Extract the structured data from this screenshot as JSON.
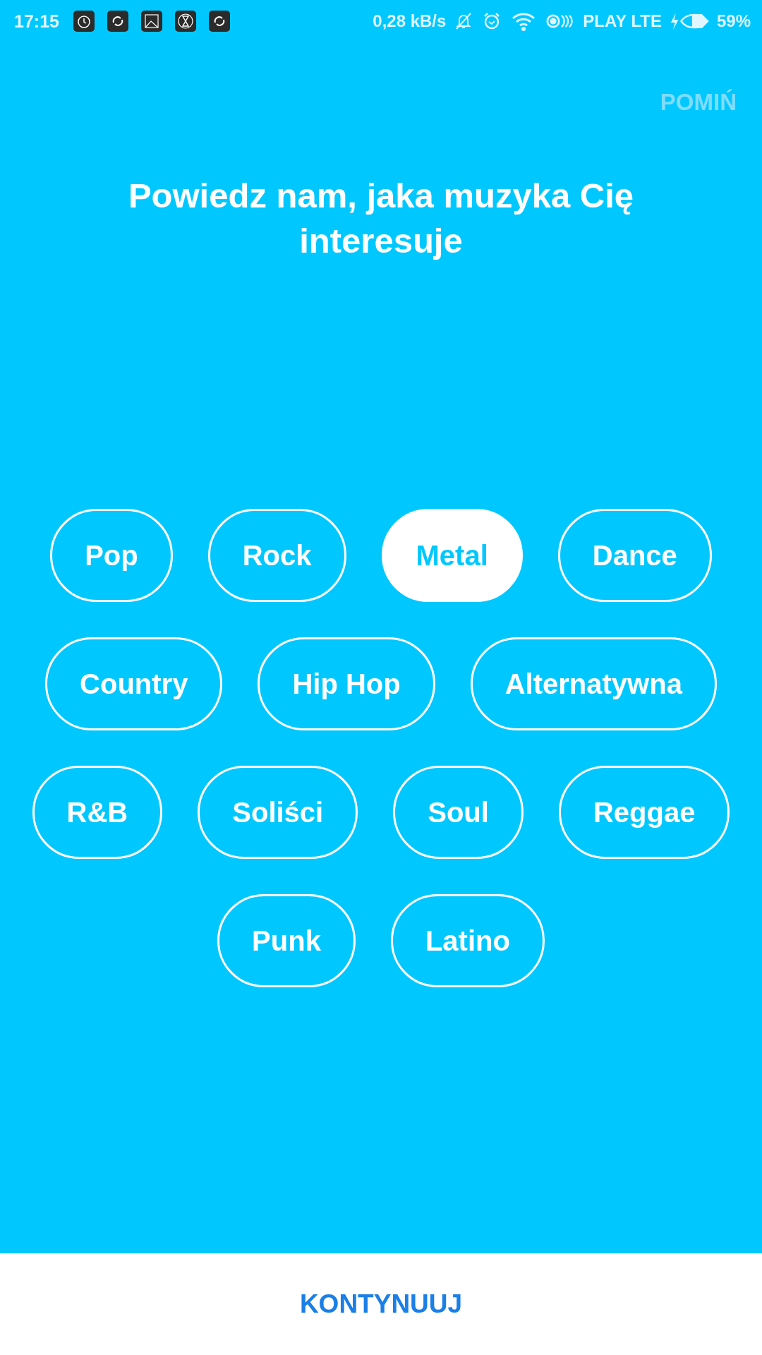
{
  "status_bar": {
    "time": "17:15",
    "speed": "0,28 kB/s",
    "carrier": "PLAY LTE",
    "battery": "59%"
  },
  "skip": "POMIŃ",
  "title": "Powiedz nam, jaka muzyka Cię interesuje",
  "genre_rows": [
    [
      {
        "label": "Pop",
        "selected": false
      },
      {
        "label": "Rock",
        "selected": false
      },
      {
        "label": "Metal",
        "selected": true
      },
      {
        "label": "Dance",
        "selected": false
      }
    ],
    [
      {
        "label": "Country",
        "selected": false
      },
      {
        "label": "Hip Hop",
        "selected": false
      },
      {
        "label": "Alternatywna",
        "selected": false
      }
    ],
    [
      {
        "label": "R&B",
        "selected": false
      },
      {
        "label": "Soliści",
        "selected": false
      },
      {
        "label": "Soul",
        "selected": false
      },
      {
        "label": "Reggae",
        "selected": false
      }
    ],
    [
      {
        "label": "Punk",
        "selected": false
      },
      {
        "label": "Latino",
        "selected": false
      }
    ]
  ],
  "continue": "KONTYNUUJ"
}
